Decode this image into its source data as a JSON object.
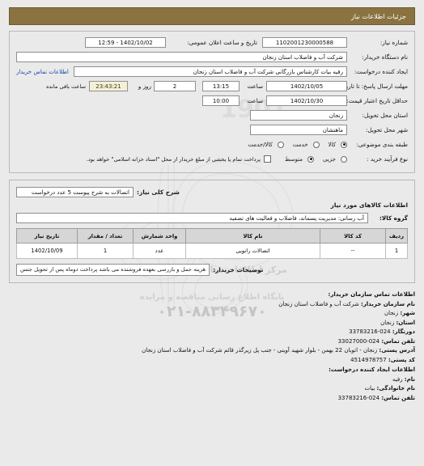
{
  "header": {
    "title": "جزئیات اطلاعات نیاز",
    "bar_color": "#8a7341"
  },
  "need_info": {
    "need_number_label": "شماره نیاز:",
    "need_number_value": "1102001230000588",
    "announce_datetime_label": "تاریخ و ساعت اعلان عمومی:",
    "announce_datetime_value": "1402/10/02 - 12:59",
    "buyer_org_label": "نام دستگاه خریدار:",
    "buyer_org_value": "شرکت آب و فاضلاب استان زنجان",
    "requester_label": "ایجاد کننده درخواست:",
    "requester_value": "رفیه بیات کارشناس بازرگانی شرکت آب و فاضلاب استان زنجان",
    "buyer_contact_link": "اطلاعات تماس خریدار",
    "response_deadline_label": "مهلت ارسال پاسخ: تا تاریخ:",
    "response_deadline_date": "1402/10/05",
    "hour_label": "ساعت",
    "response_deadline_time": "13:15",
    "days_value": "2",
    "days_label": "روز و",
    "countdown_value": "23:43:21",
    "countdown_label": "ساعت باقی مانده",
    "price_validity_label": "حداقل تاریخ اعتبار قیمت: تا تاریخ:",
    "price_validity_date": "1402/10/30",
    "price_validity_time": "10:00",
    "delivery_province_label": "استان محل تحویل:",
    "delivery_province_value": "زنجان",
    "delivery_city_label": "شهر محل تحویل:",
    "delivery_city_value": "ماهنشان",
    "category_label": "طبقه بندی موضوعی:",
    "category_options": [
      {
        "label": "کالا",
        "selected": true
      },
      {
        "label": "خدمت",
        "selected": false
      },
      {
        "label": "کالا/خدمت",
        "selected": false
      }
    ],
    "process_label": "نوع فرآیند خرید :",
    "process_options": [
      {
        "label": "جزیی",
        "selected": false
      },
      {
        "label": "متوسط",
        "selected": true
      }
    ],
    "treasury_checkbox_checked": false,
    "treasury_note": "پرداخت تمام یا بخشی از مبلغ خریدار از محل \"اسناد خزانه اسلامی\" خواهد بود."
  },
  "need_desc": {
    "summary_label": "شرح کلی نیاز:",
    "summary_value": "اتصالات به شرح پیوست 5 عدد درخواست",
    "goods_info_heading": "اطلاعات کالاهای مورد نیاز",
    "group_label": "گروه کالا:",
    "group_value": "آب رسانی: مدیریت پسماند، فاضلاب و فعالیت های تصفیه"
  },
  "goods_table": {
    "columns": [
      "ردیف",
      "کد کالا",
      "نام کالا",
      "واحد شمارش",
      "تعداد / مقدار",
      "تاریخ نیاز"
    ],
    "rows": [
      {
        "row_no": "1",
        "code": "--",
        "name": "اتصالات رانویی",
        "unit": "عدد",
        "qty": "1",
        "need_date": "1402/10/09"
      }
    ]
  },
  "buyer_notes": {
    "label": "توضیحات خریدار:",
    "value": "هزینه حمل و بازرسی بعهده فروشنده می باشد پرداخت دوماه پس از تحویل جنس"
  },
  "contact": {
    "section_title": "اطلاعات تماس سازمان خریدار:",
    "org_name_label": "نام سازمان خریدار:",
    "org_name_value": "شرکت آب و فاضلاب استان زنجان",
    "city_label": "شهر:",
    "city_value": "زنجان",
    "province_label": "استان:",
    "province_value": "زنجان",
    "fax_label": "دورنگار:",
    "fax_value": "33783216-024",
    "phone_label": "تلفن تماس:",
    "phone_value": "33027000-024",
    "address_label": "آدرس پستی:",
    "address_value": "زنجان - اتوبان 22 بهمن - بلوار شهید آوینی - جنب پل زیرگذر قائم شرکت آب و فاضلاب استان زنجان",
    "postal_code_label": "کد پستی:",
    "postal_code_value": "4514978757",
    "requester_section_title": "اطلاعات ایجاد کننده درخواست:",
    "first_name_label": "نام:",
    "first_name_value": "رفیه",
    "last_name_label": "نام خانوادگی:",
    "last_name_value": "بیات",
    "requester_phone_label": "تلفن تماس:",
    "requester_phone_value": "33783216-024"
  },
  "watermark": {
    "brand": "ParsNamadData",
    "brand_fa": "مرکز اطلاعات مناقصات و مزایدات",
    "tagline": "پایگاه اطلاع رسانی مناقصه و مزایده",
    "phone": "۰۲۱-۸۸۳۴۹۶۷۰",
    "digits": "1901"
  }
}
